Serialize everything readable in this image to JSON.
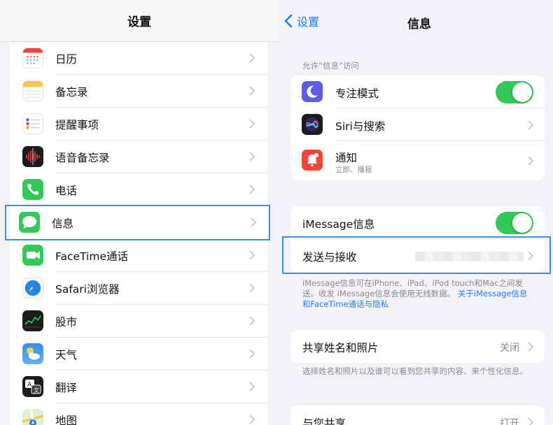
{
  "left": {
    "title": "设置",
    "items": [
      {
        "label": "日历",
        "icon": "calendar-icon"
      },
      {
        "label": "备忘录",
        "icon": "notes-icon"
      },
      {
        "label": "提醒事项",
        "icon": "reminders-icon"
      },
      {
        "label": "语音备忘录",
        "icon": "voice-memos-icon"
      },
      {
        "label": "电话",
        "icon": "phone-icon"
      },
      {
        "label": "信息",
        "icon": "messages-icon",
        "selected": true
      },
      {
        "label": "FaceTime通话",
        "icon": "facetime-icon"
      },
      {
        "label": "Safari浏览器",
        "icon": "safari-icon"
      },
      {
        "label": "股市",
        "icon": "stocks-icon"
      },
      {
        "label": "天气",
        "icon": "weather-icon"
      },
      {
        "label": "翻译",
        "icon": "translate-icon"
      },
      {
        "label": "地图",
        "icon": "maps-icon"
      }
    ]
  },
  "right": {
    "back_label": "设置",
    "title": "信息",
    "access_header": "允许“信息”访问",
    "access": {
      "focus": "专注模式",
      "siri": "Siri与搜索",
      "notifications": "通知",
      "notifications_sub": "立即、播报"
    },
    "imessage": {
      "label": "iMessage信息",
      "send_receive": "发送与接收",
      "note": "iMessage信息可在iPhone、iPad、iPod touch和Mac之间发送。收发 iMessage信息会使用无线数据。",
      "note_link": "关于iMessage信息和FaceTime通话与隐私"
    },
    "share_name": {
      "label": "共享姓名和照片",
      "value": "关闭",
      "note": "选择姓名和照片以及谁可以看到您共享的内容、来个性化信息。"
    },
    "shared_with_you": {
      "label": "与您共享",
      "value": "打开"
    }
  },
  "colors": {
    "accent": "#1e7cf0",
    "toggle_on": "#34c759",
    "highlight": "#3a8fd8"
  }
}
